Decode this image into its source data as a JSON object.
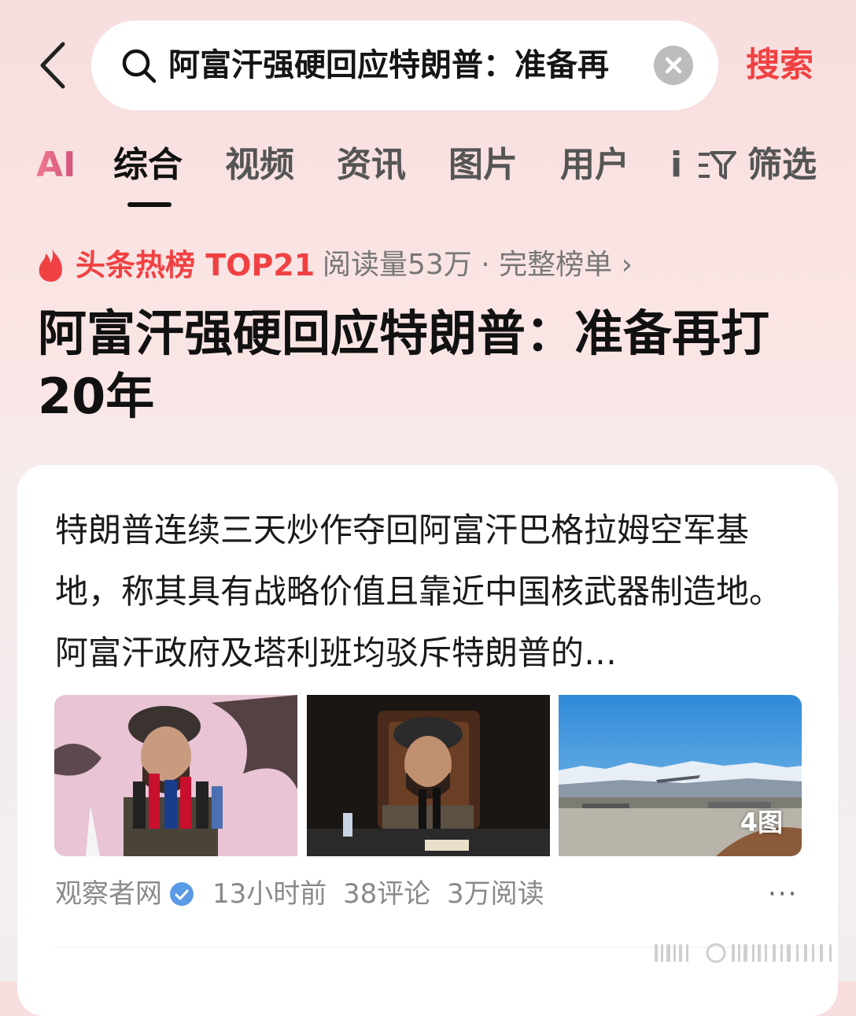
{
  "search": {
    "value": "阿富汗强硬回应特朗普：准备再",
    "button_label": "搜索"
  },
  "tabs": {
    "ai_label": "AI",
    "items": [
      {
        "label": "综合"
      },
      {
        "label": "视频"
      },
      {
        "label": "资讯"
      },
      {
        "label": "图片"
      },
      {
        "label": "用户"
      }
    ],
    "overflow_label": "i",
    "filter_label": "筛选"
  },
  "hot_list": {
    "label": "头条热榜 TOP21",
    "meta": "阅读量53万 · 完整榜单 ›"
  },
  "headline": "阿富汗强硬回应特朗普：准备再打20年",
  "article": {
    "summary": "特朗普连续三天炒作夺回阿富汗巴格拉姆空军基地，称其具有战略价值且靠近中国核武器制造地。阿富汗政府及塔利班均驳斥特朗普的…",
    "image_count_label": "4图",
    "source": "观察者网",
    "time": "13小时前",
    "comments": "38评论",
    "reads": "3万阅读",
    "more_label": "···"
  },
  "colors": {
    "accent": "#f04142",
    "ai_gradient": [
      "#f07a8e",
      "#d1527a"
    ],
    "verified": "#5b9ae6"
  },
  "icons": {
    "back": "chevron-left-icon",
    "search": "search-icon",
    "clear": "close-circle-icon",
    "filter": "funnel-icon",
    "hot": "flame-icon",
    "verified": "check-badge-icon",
    "more": "ellipsis-icon"
  }
}
